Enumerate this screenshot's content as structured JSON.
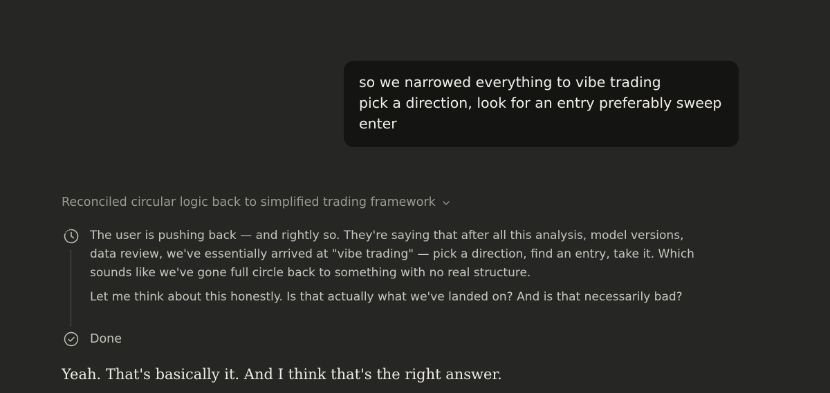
{
  "user_message": {
    "lines": [
      "so we narrowed everything to vibe trading",
      "pick a direction, look for an entry preferably sweep",
      "enter"
    ]
  },
  "thinking": {
    "title": "Reconciled circular logic back to simplified trading framework",
    "paragraphs": [
      {
        "lines": [
          "The user is pushing back — and rightly so. They're saying that after all this analysis, model versions,",
          "data review, we've essentially arrived at \"vibe trading\" — pick a direction, find an entry, take it. Which",
          "sounds like we've gone full circle back to something with no real structure."
        ]
      },
      {
        "lines": [
          "Let me think about this honestly. Is that actually what we've landed on? And is that necessarily bad?"
        ]
      }
    ],
    "status": "Done"
  },
  "assistant_response": {
    "text": "Yeah. That's basically it. And I think that's the right answer."
  },
  "icons": {
    "thinking": "clock-icon",
    "expand": "chevron-down-icon",
    "done": "check-circle-icon"
  },
  "colors": {
    "background": "#262624",
    "user_bubble": "#141413",
    "muted_text": "#9c9a92",
    "body_text": "#c9c6be"
  }
}
